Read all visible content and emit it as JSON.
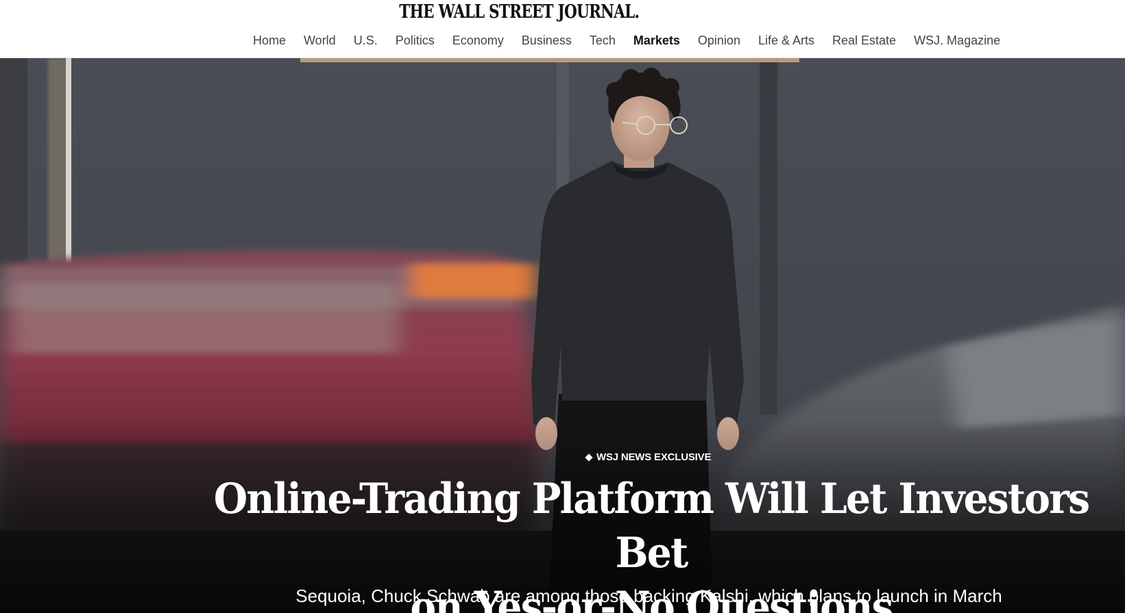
{
  "masthead": "THE WALL STREET JOURNAL.",
  "nav": {
    "items": [
      {
        "label": "Home",
        "active": false
      },
      {
        "label": "World",
        "active": false
      },
      {
        "label": "U.S.",
        "active": false
      },
      {
        "label": "Politics",
        "active": false
      },
      {
        "label": "Economy",
        "active": false
      },
      {
        "label": "Business",
        "active": false
      },
      {
        "label": "Tech",
        "active": false
      },
      {
        "label": "Markets",
        "active": true
      },
      {
        "label": "Opinion",
        "active": false
      },
      {
        "label": "Life & Arts",
        "active": false
      },
      {
        "label": "Real Estate",
        "active": false
      },
      {
        "label": "WSJ. Magazine",
        "active": false
      }
    ]
  },
  "article": {
    "kicker": "WSJ NEWS EXCLUSIVE",
    "headline_line1": "Online-Trading Platform Will Let Investors Bet",
    "headline_line2": "on Yes-or-No Questions",
    "dek": "Sequoia, Chuck Schwab are among those backing Kalshi, which plans to launch in March"
  },
  "colors": {
    "background": "#ffffff",
    "nav_text": "#444444",
    "nav_active": "#111111",
    "hero_wall": "#4b4e56",
    "overlay_text": "#ffffff"
  },
  "icons": {
    "kicker": "diamond-icon"
  }
}
